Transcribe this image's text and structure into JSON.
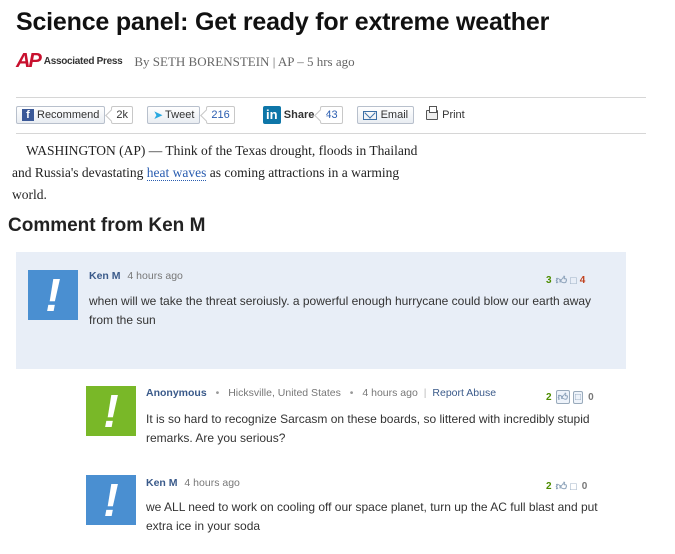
{
  "article": {
    "headline": "Science panel: Get ready for extreme weather",
    "source_logo": "AP",
    "source_name": "Associated Press",
    "byline": "By SETH BORENSTEIN | AP – 5 hrs ago",
    "body_before_link": "WASHINGTON (AP) — Think of the Texas drought, floods in Thailand and Russia's devastating ",
    "body_link": "heat waves",
    "body_after_link": " as coming attractions in a warming world."
  },
  "share": {
    "recommend_label": "Recommend",
    "recommend_count": "2k",
    "tweet_label": "Tweet",
    "tweet_count": "216",
    "linkedin_label": "Share",
    "linkedin_count": "43",
    "email_label": "Email",
    "print_label": "Print"
  },
  "comments_section": {
    "title": "Comment from Ken M"
  },
  "comments": [
    {
      "author": "Ken M",
      "time": "4 hours ago",
      "body": "when will we take the threat seroiusly. a powerful enough hurrycane could blow our earth away from the sun",
      "up": "3",
      "down": "4",
      "avatar_color": "#4a8fd1"
    },
    {
      "author": "Anonymous",
      "location": "Hicksville, United States",
      "time": "4 hours ago",
      "report": "Report Abuse",
      "body": "It is so hard to recognize Sarcasm on these boards, so littered with incredibly stupid remarks. Are you serious?",
      "up": "2",
      "down": "0",
      "avatar_color": "#79b828"
    },
    {
      "author": "Ken M",
      "time": "4 hours ago",
      "body": "we ALL need to work on cooling off our space planet, turn up the AC full blast and put extra ice in your soda",
      "up": "2",
      "down": "0",
      "avatar_color": "#4a8fd1"
    }
  ]
}
